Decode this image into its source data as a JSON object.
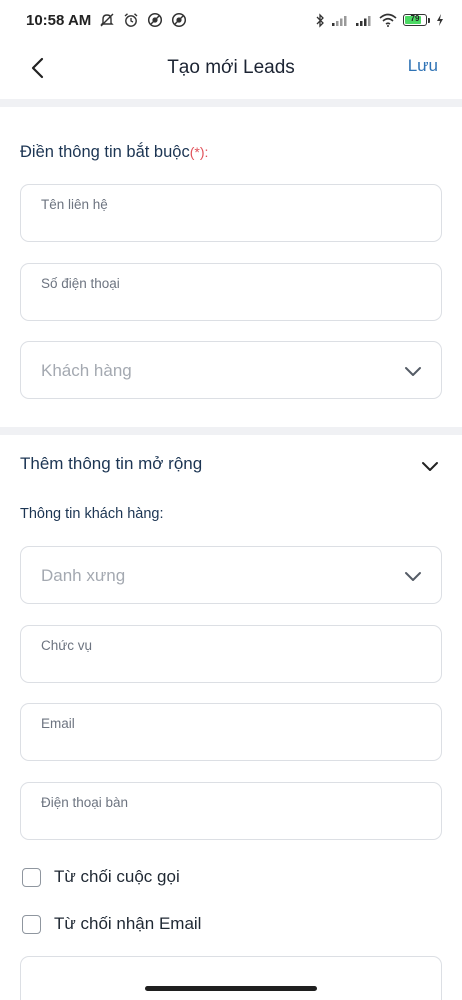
{
  "status_bar": {
    "time": "10:58 AM",
    "battery_level": "79",
    "left_icons": [
      "mute-icon",
      "alarm-icon",
      "vpn-icon",
      "vpn-icon"
    ],
    "right_icons": [
      "bluetooth-icon",
      "signal-icon",
      "signal-icon",
      "wifi-icon",
      "battery-icon",
      "charging-icon"
    ]
  },
  "header": {
    "title": "Tạo mới Leads",
    "save_label": "Lưu"
  },
  "required_section": {
    "title": "Điền thông tin bắt buộc",
    "required_mark": "(*):",
    "fields": {
      "contact_name_label": "Tên liên hệ",
      "phone_label": "Số điện thoại",
      "customer_placeholder": "Khách hàng"
    }
  },
  "extended_section": {
    "title": "Thêm thông tin mở rộng",
    "subtitle": "Thông tin khách hàng:",
    "fields": {
      "salutation_placeholder": "Danh xưng",
      "position_label": "Chức vụ",
      "email_label": "Email",
      "landline_label": "Điện thoại bàn"
    },
    "checkboxes": {
      "decline_call": "Từ chối cuộc gọi",
      "decline_email": "Từ chối nhận Email"
    }
  },
  "colors": {
    "accent": "#2f73b5",
    "required": "#e0525a",
    "border": "#dcdfe4",
    "section_band": "#f0f1f4"
  }
}
